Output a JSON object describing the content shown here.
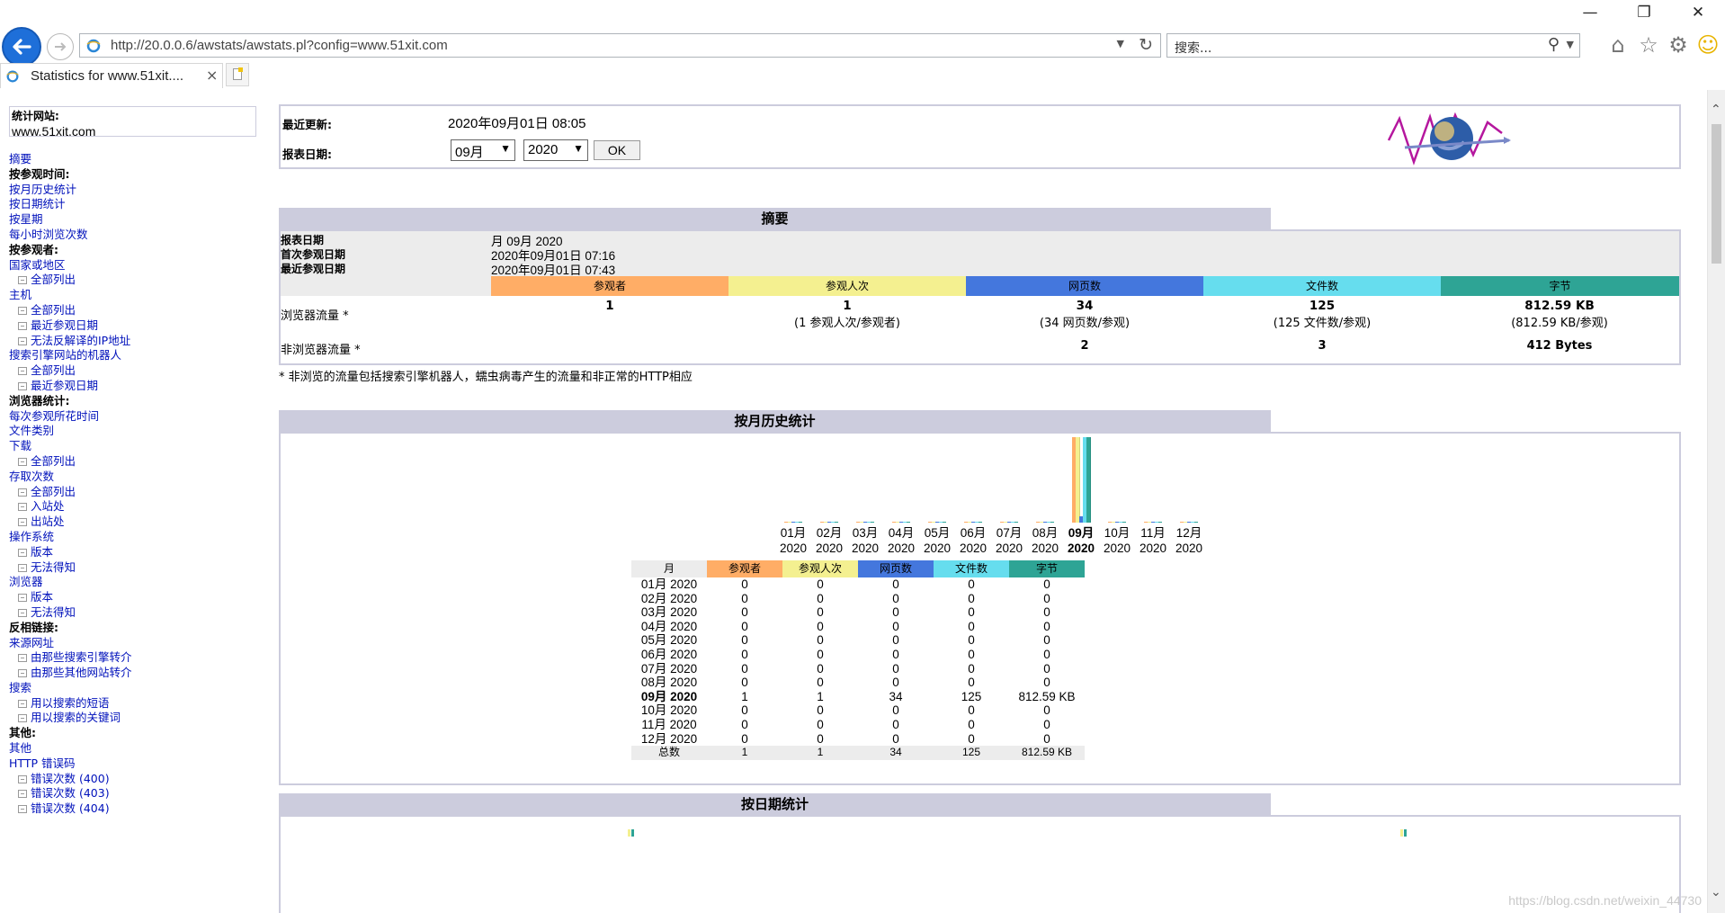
{
  "browser": {
    "url": "http://20.0.0.6/awstats/awstats.pl?config=www.51xit.com",
    "search_placeholder": "搜索...",
    "tab_title": "Statistics for www.51xit....",
    "tab_close": "×"
  },
  "menu": {
    "site_label": "统计网站:",
    "site_value": "www.51xit.com",
    "items": [
      {
        "text": "摘要",
        "type": "lnk"
      },
      {
        "text": "按参观时间:",
        "type": "h"
      },
      {
        "text": "按月历史统计",
        "type": "lnk"
      },
      {
        "text": "按日期统计",
        "type": "lnk"
      },
      {
        "text": "按星期",
        "type": "lnk"
      },
      {
        "text": "每小时浏览次数",
        "type": "lnk"
      },
      {
        "text": "按参观者:",
        "type": "h"
      },
      {
        "text": "国家或地区",
        "type": "lnk"
      },
      {
        "text": "全部列出",
        "type": "sub"
      },
      {
        "text": "主机",
        "type": "lnk"
      },
      {
        "text": "全部列出",
        "type": "sub"
      },
      {
        "text": "最近参观日期",
        "type": "sub"
      },
      {
        "text": "无法反解译的IP地址",
        "type": "sub"
      },
      {
        "text": "搜索引擎网站的机器人",
        "type": "lnk"
      },
      {
        "text": "全部列出",
        "type": "sub"
      },
      {
        "text": "最近参观日期",
        "type": "sub"
      },
      {
        "text": "浏览器统计:",
        "type": "h"
      },
      {
        "text": "每次参观所花时间",
        "type": "lnk"
      },
      {
        "text": "文件类别",
        "type": "lnk"
      },
      {
        "text": "下载",
        "type": "lnk"
      },
      {
        "text": "全部列出",
        "type": "sub"
      },
      {
        "text": "存取次数",
        "type": "lnk"
      },
      {
        "text": "全部列出",
        "type": "sub"
      },
      {
        "text": "入站处",
        "type": "sub"
      },
      {
        "text": "出站处",
        "type": "sub"
      },
      {
        "text": "操作系统",
        "type": "lnk"
      },
      {
        "text": "版本",
        "type": "sub"
      },
      {
        "text": "无法得知",
        "type": "sub"
      },
      {
        "text": "浏览器",
        "type": "lnk"
      },
      {
        "text": "版本",
        "type": "sub"
      },
      {
        "text": "无法得知",
        "type": "sub"
      },
      {
        "text": "反相链接:",
        "type": "h"
      },
      {
        "text": "来源网址",
        "type": "lnk"
      },
      {
        "text": "由那些搜索引擎转介",
        "type": "sub"
      },
      {
        "text": "由那些其他网站转介",
        "type": "sub"
      },
      {
        "text": "搜索",
        "type": "lnk"
      },
      {
        "text": "用以搜索的短语",
        "type": "sub"
      },
      {
        "text": "用以搜索的关键词",
        "type": "sub"
      },
      {
        "text": "其他:",
        "type": "h"
      },
      {
        "text": "其他",
        "type": "lnk"
      },
      {
        "text": "HTTP 错误码",
        "type": "lnk"
      },
      {
        "text": "错误次数 (400)",
        "type": "sub"
      },
      {
        "text": "错误次数 (403)",
        "type": "sub"
      },
      {
        "text": "错误次数 (404)",
        "type": "sub"
      }
    ]
  },
  "info": {
    "last_update_label": "最近更新:",
    "last_update_value": "2020年09月01日 08:05",
    "report_date_label": "报表日期:",
    "month_select": "09月",
    "year_select": "2020",
    "ok_label": "OK"
  },
  "summary": {
    "title": "摘要",
    "report_date_label": "报表日期",
    "report_date_value": "月 09月 2020",
    "first_visit_label": "首次参观日期",
    "first_visit_value": "2020年09月01日 07:16",
    "last_visit_label": "最近参观日期",
    "last_visit_value": "2020年09月01日 07:43",
    "columns": [
      {
        "label": "参观者",
        "color": "#ffad66"
      },
      {
        "label": "参观人次",
        "color": "#f4f090"
      },
      {
        "label": "网页数",
        "color": "#4477dd"
      },
      {
        "label": "文件数",
        "color": "#66ddee"
      },
      {
        "label": "字节",
        "color": "#2ea495"
      }
    ],
    "browser_traffic_label": "浏览器流量 *",
    "browser_traffic": [
      {
        "main": "1",
        "sub": ""
      },
      {
        "main": "1",
        "sub": "(1 参观人次/参观者)"
      },
      {
        "main": "34",
        "sub": "(34 网页数/参观)"
      },
      {
        "main": "125",
        "sub": "(125 文件数/参观)"
      },
      {
        "main": "812.59 KB",
        "sub": "(812.59 KB/参观)"
      }
    ],
    "non_browser_label": "非浏览器流量 *",
    "non_browser": [
      "",
      "",
      "2",
      "3",
      "412 Bytes"
    ],
    "footnote": "* 非浏览的流量包括搜索引擎机器人，蠕虫病毒产生的流量和非正常的HTTP相应"
  },
  "monthly": {
    "title": "按月历史统计",
    "table_headers": [
      "月",
      "参观者",
      "参观人次",
      "网页数",
      "文件数",
      "字节"
    ],
    "rows": [
      [
        "01月 2020",
        "0",
        "0",
        "0",
        "0",
        "0"
      ],
      [
        "02月 2020",
        "0",
        "0",
        "0",
        "0",
        "0"
      ],
      [
        "03月 2020",
        "0",
        "0",
        "0",
        "0",
        "0"
      ],
      [
        "04月 2020",
        "0",
        "0",
        "0",
        "0",
        "0"
      ],
      [
        "05月 2020",
        "0",
        "0",
        "0",
        "0",
        "0"
      ],
      [
        "06月 2020",
        "0",
        "0",
        "0",
        "0",
        "0"
      ],
      [
        "07月 2020",
        "0",
        "0",
        "0",
        "0",
        "0"
      ],
      [
        "08月 2020",
        "0",
        "0",
        "0",
        "0",
        "0"
      ],
      [
        "09月 2020",
        "1",
        "1",
        "34",
        "125",
        "812.59 KB"
      ],
      [
        "10月 2020",
        "0",
        "0",
        "0",
        "0",
        "0"
      ],
      [
        "11月 2020",
        "0",
        "0",
        "0",
        "0",
        "0"
      ],
      [
        "12月 2020",
        "0",
        "0",
        "0",
        "0",
        "0"
      ]
    ],
    "total_row": [
      "总数",
      "1",
      "1",
      "34",
      "125",
      "812.59 KB"
    ],
    "highlight_month": "09月 2020"
  },
  "chart_data": {
    "type": "bar",
    "categories": [
      "01月 2020",
      "02月 2020",
      "03月 2020",
      "04月 2020",
      "05月 2020",
      "06月 2020",
      "07月 2020",
      "08月 2020",
      "09月 2020",
      "10月 2020",
      "11月 2020",
      "12月 2020"
    ],
    "series": [
      {
        "name": "参观者",
        "values": [
          0,
          0,
          0,
          0,
          0,
          0,
          0,
          0,
          1,
          0,
          0,
          0
        ]
      },
      {
        "name": "参观人次",
        "values": [
          0,
          0,
          0,
          0,
          0,
          0,
          0,
          0,
          1,
          0,
          0,
          0
        ]
      },
      {
        "name": "网页数",
        "values": [
          0,
          0,
          0,
          0,
          0,
          0,
          0,
          0,
          34,
          0,
          0,
          0
        ]
      },
      {
        "name": "文件数",
        "values": [
          0,
          0,
          0,
          0,
          0,
          0,
          0,
          0,
          125,
          0,
          0,
          0
        ]
      },
      {
        "name": "字节",
        "values": [
          0,
          0,
          0,
          0,
          0,
          0,
          0,
          0,
          812.59,
          0,
          0,
          0
        ]
      }
    ],
    "title": "按月历史统计",
    "xlabel": "",
    "ylabel": ""
  },
  "daily": {
    "title": "按日期统计"
  },
  "watermark": "https://blog.csdn.net/weixin_44730"
}
